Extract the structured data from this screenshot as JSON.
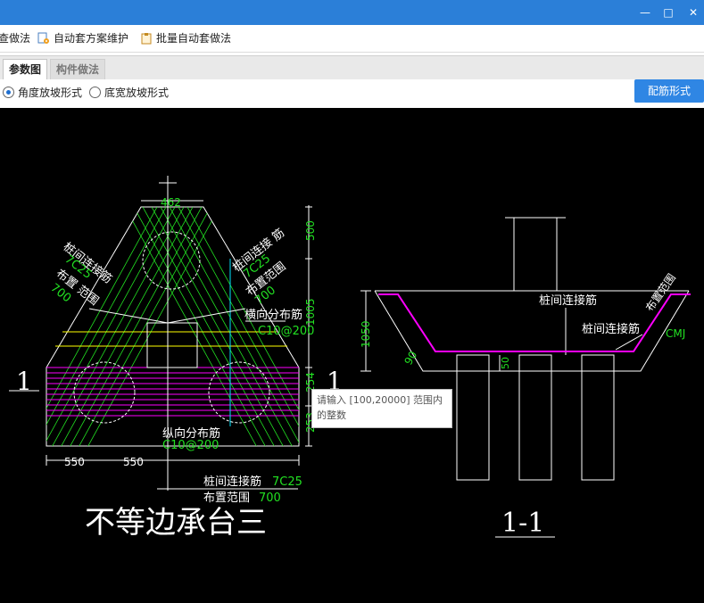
{
  "toolbar": {
    "items": [
      {
        "label": "查做法"
      },
      {
        "label": "自动套方案维护"
      },
      {
        "label": "批量自动套做法"
      }
    ]
  },
  "tabs": [
    {
      "label": "参数图",
      "active": true
    },
    {
      "label": "构件做法",
      "active": false
    }
  ],
  "options": {
    "angle": "角度放坡形式",
    "width": "底宽放坡形式",
    "selected": "angle"
  },
  "rebar_button": "配筋形式",
  "drawing": {
    "dim_top": "462",
    "dim_500": "500",
    "dim_1005": "1005",
    "dim_254": "254",
    "dim_253": "253",
    "dim_550a": "550",
    "dim_550b": "550",
    "lbl_left_a": "桩间连接筋",
    "lbl_left_b": "7C25",
    "lbl_left_c": "布置 范围",
    "lbl_left_d": "700",
    "lbl_right_a": "桩间连接 筋",
    "lbl_right_b": "7C25",
    "lbl_right_c": "布置范围",
    "lbl_right_d": "700",
    "lbl_trans_a": "横向分布筋",
    "lbl_trans_b": "C10@200",
    "lbl_long_a": "纵向分布筋",
    "lbl_long_b": "C10@200",
    "lbl_bottom_a": "桩间连接筋",
    "lbl_bottom_b": "7C25",
    "lbl_bottom_c": "布置范围",
    "lbl_bottom_d": "700",
    "sec_marker_l": "1",
    "sec_marker_r": "1",
    "title_plan": "不等边承台三",
    "sec_lbl1": "桩间连接筋",
    "sec_lbl2": "桩间连接筋",
    "sec_dim_1050": "1050",
    "sec_dim_50": "50",
    "sec_angle": "90",
    "sec_ramp": "布置范围",
    "sec_cmj": "CMJ",
    "title_sec": "1-1"
  },
  "tooltip": {
    "line1": "请输入 [100,20000] 范围内",
    "line2": "的整数"
  },
  "colors": {
    "titlebar": "#2b7fd8",
    "button": "#2f86e4",
    "cad_bg": "#000000",
    "green": "#22e022",
    "magenta": "#ff00ff",
    "yellow": "#ffff00",
    "cyan": "#00e5ff"
  }
}
